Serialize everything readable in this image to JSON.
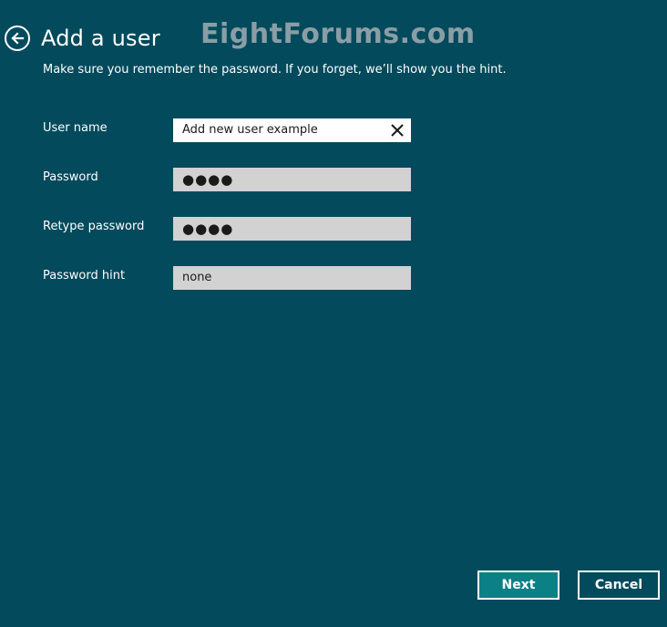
{
  "header": {
    "back_icon": "back-arrow-icon",
    "title": "Add a user"
  },
  "watermark": "EightForums.com",
  "subtitle": "Make sure you remember the password. If you forget, we’ll show you the hint.",
  "form": {
    "fields": [
      {
        "label": "User name",
        "value": "Add new user example",
        "clear_icon": "close-icon"
      },
      {
        "label": "Password",
        "value": "●●●●"
      },
      {
        "label": "Retype password",
        "value": "●●●●"
      },
      {
        "label": "Password hint",
        "value": "none"
      }
    ]
  },
  "buttons": {
    "next_label": "Next",
    "cancel_label": "Cancel"
  },
  "colors": {
    "background": "#034a5c",
    "field_bg": "#d2d2d2",
    "active_field_bg": "#ffffff",
    "next_button_bg": "#0b8185",
    "watermark": "#8a9ea6"
  }
}
